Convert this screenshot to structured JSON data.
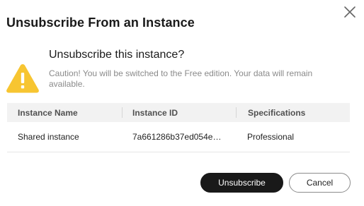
{
  "dialog": {
    "title": "Unsubscribe From an Instance",
    "question": "Unsubscribe this instance?",
    "caution": "Caution! You will be switched to the Free edition. Your data will remain available.",
    "icons": {
      "close": "close-icon",
      "warning": "warning-icon"
    },
    "colors": {
      "warning": "#f7c531",
      "primary_button": "#191919"
    }
  },
  "table": {
    "headers": [
      "Instance Name",
      "Instance ID",
      "Specifications"
    ],
    "rows": [
      [
        "Shared instance",
        "7a661286b37ed054e…",
        "Professional"
      ]
    ]
  },
  "buttons": {
    "confirm": "Unsubscribe",
    "cancel": "Cancel"
  }
}
